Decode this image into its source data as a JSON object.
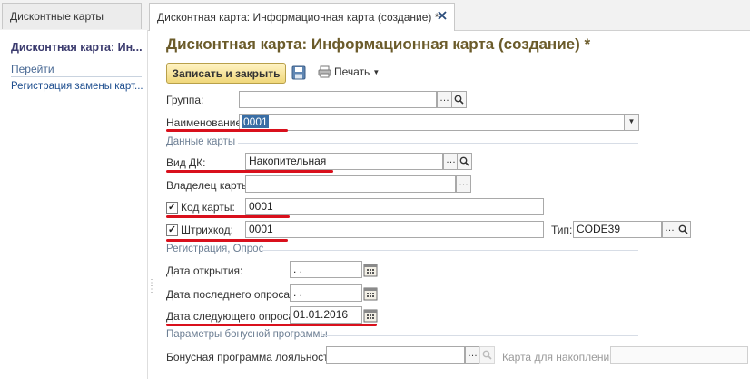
{
  "tabs": [
    {
      "label": "Дисконтные карты",
      "active": false
    },
    {
      "label": "Дисконтная карта: Информационная карта (создание) *",
      "active": true
    }
  ],
  "left_panel": {
    "title": "Дисконтная карта: Ин...",
    "goto_label": "Перейти",
    "links": [
      "Регистрация замены карт..."
    ]
  },
  "form": {
    "title": "Дисконтная карта: Информационная карта (создание) *",
    "toolbar": {
      "save_close_label": "Записать и закрыть",
      "print_label": "Печать"
    },
    "group": {
      "label": "Группа:",
      "value": ""
    },
    "name": {
      "label": "Наименование:",
      "value": "0001"
    },
    "section_card_data": "Данные карты",
    "card_type": {
      "label": "Вид ДК:",
      "value": "Накопительная"
    },
    "owner": {
      "label": "Владелец карты:",
      "value": ""
    },
    "card_code": {
      "label": "Код карты:",
      "value": "0001",
      "checked": true
    },
    "barcode": {
      "label": "Штрихкод:",
      "value": "0001",
      "checked": true
    },
    "barcode_type": {
      "label": "Тип:",
      "value": "CODE39"
    },
    "section_registration": "Регистрация, Опрос",
    "open_date": {
      "label": "Дата открытия:",
      "value": " .  ."
    },
    "last_survey_date": {
      "label": "Дата последнего опроса:",
      "value": " .  ."
    },
    "next_survey_date": {
      "label": "Дата следующего опроса:",
      "value": "01.01.2016"
    },
    "section_bonus": "Параметры бонусной программы",
    "bonus_program": {
      "label": "Бонусная программа лояльности:",
      "value": ""
    },
    "accum_card": {
      "label": "Карта для накоплений:",
      "value": ""
    }
  },
  "colors": {
    "annotation_underline": "#d9101c",
    "accent_title": "#6b5b2a",
    "selection": "#3a6ea5"
  }
}
